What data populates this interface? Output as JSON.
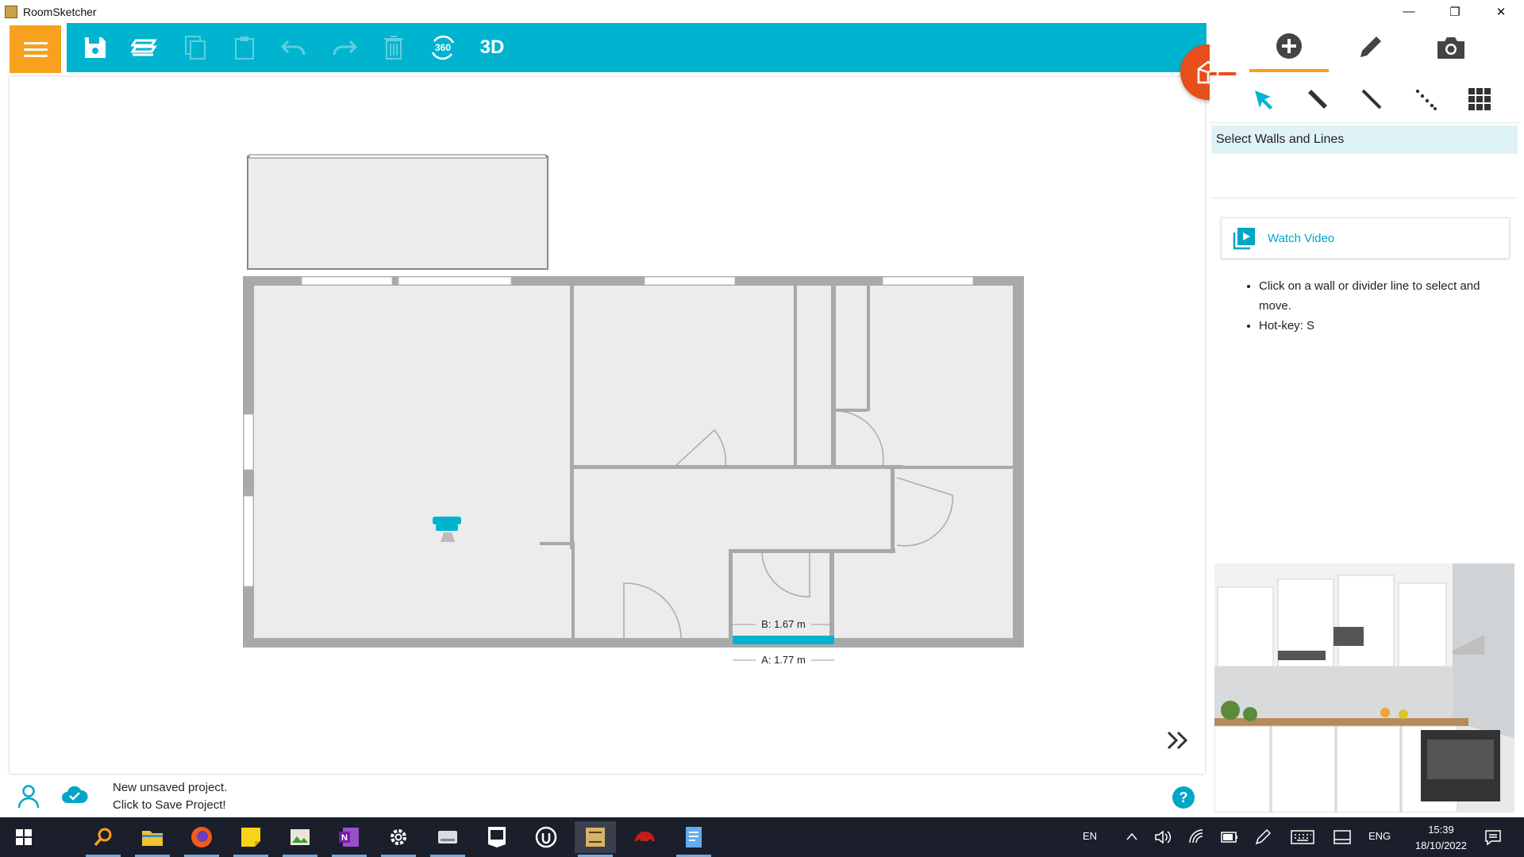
{
  "window": {
    "title": "RoomSketcher",
    "minimize": "—",
    "restore": "❐",
    "close": "✕"
  },
  "toolbar": {
    "menu_icon": "hamburger-icon",
    "items": [
      {
        "name": "save-icon"
      },
      {
        "name": "levels-icon"
      },
      {
        "name": "copy-icon",
        "disabled": true
      },
      {
        "name": "paste-icon",
        "disabled": true
      },
      {
        "name": "undo-icon",
        "disabled": true
      },
      {
        "name": "redo-icon",
        "disabled": true
      },
      {
        "name": "delete-icon",
        "disabled": true
      },
      {
        "name": "view-360-icon",
        "label": "360"
      },
      {
        "name": "view-3d",
        "label": "3D"
      }
    ],
    "accent": "#00b4d0",
    "menu_color": "#f7a11f"
  },
  "right_panel": {
    "tabs": [
      {
        "name": "add-icon",
        "active": true
      },
      {
        "name": "edit-icon",
        "active": false
      },
      {
        "name": "camera-icon",
        "active": false
      }
    ],
    "tools": [
      "select-arrow-icon",
      "wall-tool-icon",
      "line-tool-icon",
      "dotted-line-icon",
      "grid-icon"
    ],
    "header": "Select Walls and Lines",
    "watch_video": "Watch Video",
    "help": [
      "Click on a wall or divider line to select and move.",
      "Hot-key: S"
    ]
  },
  "floorplan": {
    "dimension_b": "B: 1.67 m",
    "dimension_a": "A: 1.77 m",
    "selection_color": "#00b4d0"
  },
  "status": {
    "line1": "New unsaved project.",
    "line2": "Click to Save Project!"
  },
  "taskbar": {
    "lang1": "EN",
    "lang2": "ENG",
    "time": "15:39",
    "date": "18/10/2022"
  }
}
